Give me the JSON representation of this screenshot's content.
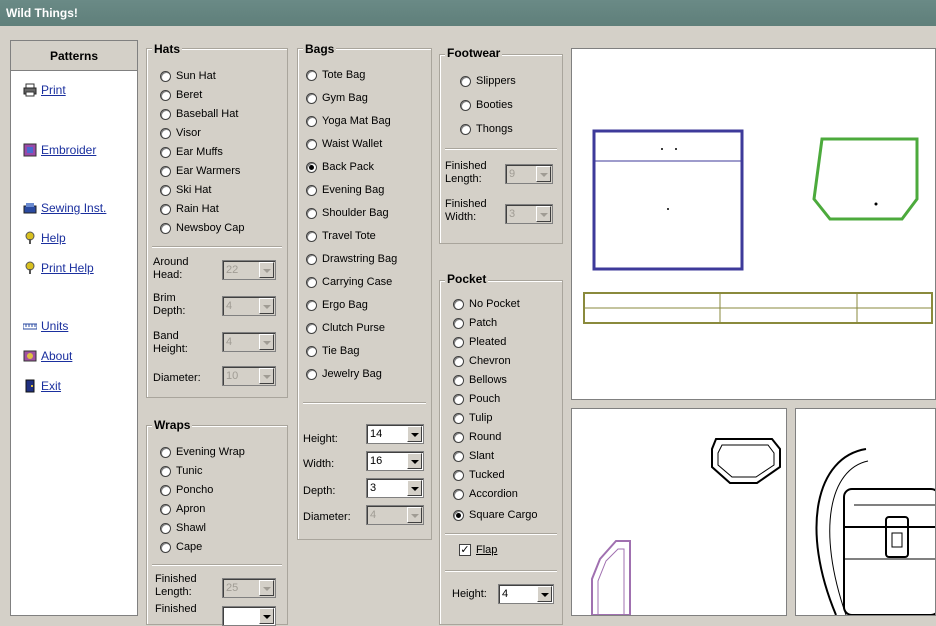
{
  "window": {
    "title": "Wild Things!"
  },
  "sidebar": {
    "header": "Patterns",
    "items": [
      {
        "label": "Print",
        "icon": "printer-icon"
      },
      {
        "label": "Embroider",
        "icon": "embroider-icon"
      },
      {
        "label": "Sewing Inst.",
        "icon": "sewing-icon"
      },
      {
        "label": "Help",
        "icon": "help-icon"
      },
      {
        "label": "Print Help",
        "icon": "print-help-icon"
      },
      {
        "label": "Units",
        "icon": "ruler-icon"
      },
      {
        "label": "About",
        "icon": "about-icon"
      },
      {
        "label": "Exit",
        "icon": "exit-icon"
      }
    ]
  },
  "hats": {
    "title": "Hats",
    "options": [
      "Sun Hat",
      "Beret",
      "Baseball Hat",
      "Visor",
      "Ear Muffs",
      "Ear Warmers",
      "Ski Hat",
      "Rain Hat",
      "Newsboy Cap"
    ],
    "around_head_label": "Around Head:",
    "around_head": "22",
    "brim_depth_label": "Brim Depth:",
    "brim_depth": "4",
    "band_height_label": "Band Height:",
    "band_height": "4",
    "diameter_label": "Diameter:",
    "diameter": "10"
  },
  "wraps": {
    "title": "Wraps",
    "options": [
      "Evening Wrap",
      "Tunic",
      "Poncho",
      "Apron",
      "Shawl",
      "Cape"
    ],
    "finished_length_label": "Finished Length:",
    "finished_length": "25",
    "finished_width_label": "Finished"
  },
  "bags": {
    "title": "Bags",
    "options": [
      "Tote Bag",
      "Gym Bag",
      "Yoga Mat Bag",
      "Waist Wallet",
      "Back Pack",
      "Evening Bag",
      "Shoulder Bag",
      "Travel Tote",
      "Drawstring Bag",
      "Carrying Case",
      "Ergo Bag",
      "Clutch Purse",
      "Tie Bag",
      "Jewelry Bag"
    ],
    "selected": "Back Pack",
    "height_label": "Height:",
    "height": "14",
    "width_label": "Width:",
    "width": "16",
    "depth_label": "Depth:",
    "depth": "3",
    "diameter_label": "Diameter:",
    "diameter": "4"
  },
  "footwear": {
    "title": "Footwear",
    "options": [
      "Slippers",
      "Booties",
      "Thongs"
    ],
    "finished_length_label": "Finished Length:",
    "finished_length": "9",
    "finished_width_label": "Finished Width:",
    "finished_width": "3"
  },
  "pocket": {
    "title": "Pocket",
    "options": [
      "No Pocket",
      "Patch",
      "Pleated",
      "Chevron",
      "Bellows",
      "Pouch",
      "Tulip",
      "Round",
      "Slant",
      "Tucked",
      "Accordion",
      "Square Cargo"
    ],
    "selected": "Square Cargo",
    "flap_label": "Flap",
    "flap_checked": true,
    "height_label": "Height:",
    "height": "4"
  },
  "colors": {
    "pattern_blue": "#3d3a9a",
    "pattern_green": "#4caa3c",
    "pattern_olive": "#8a8a3c",
    "pattern_purple": "#a070b0"
  }
}
